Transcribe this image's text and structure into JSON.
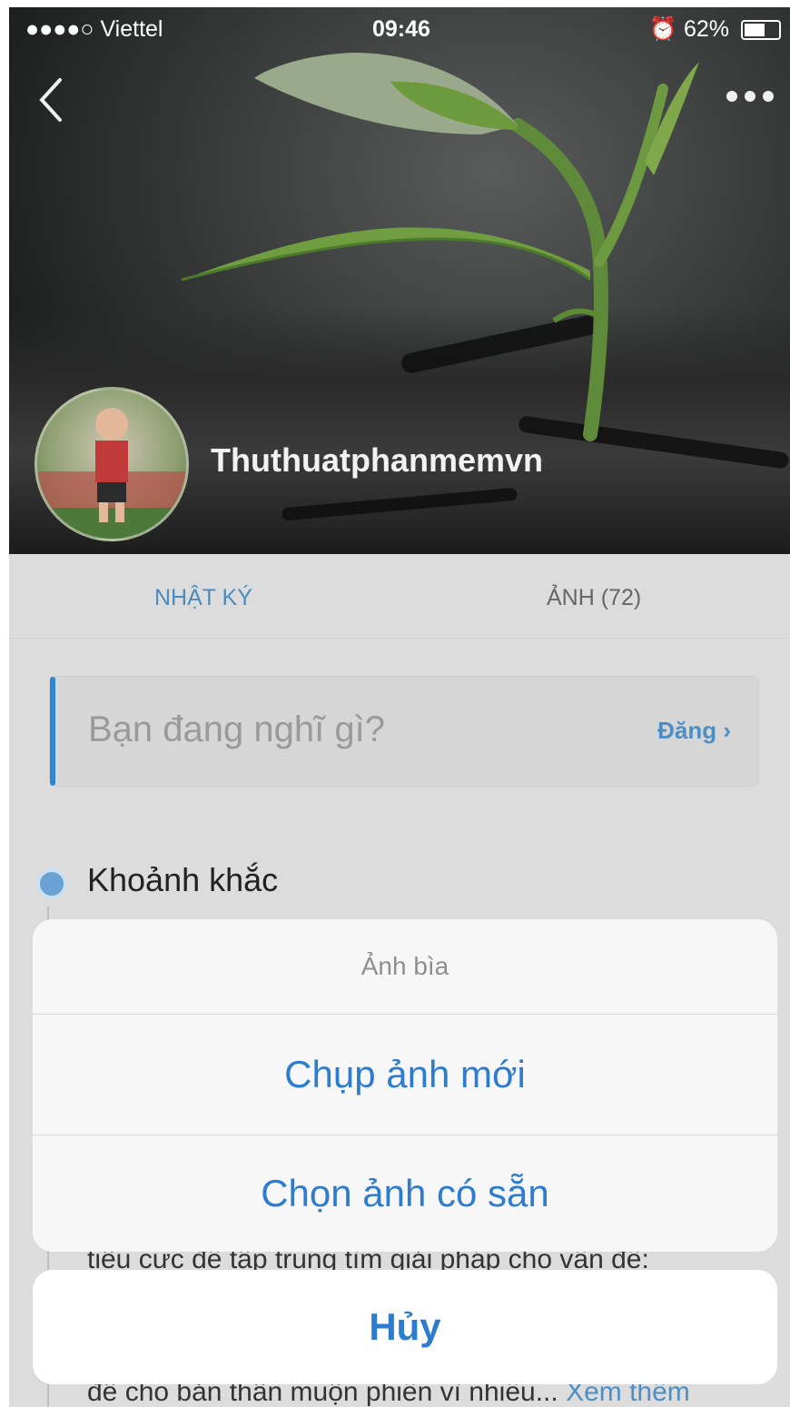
{
  "status_bar": {
    "carrier": "●●●●○ Viettel",
    "time": "09:46",
    "battery": "62%",
    "battery_level": 0.62
  },
  "profile": {
    "name": "Thuthuatphanmemvn"
  },
  "tabs": [
    {
      "label": "NHẬT KÝ"
    },
    {
      "label": "ẢNH (72)"
    }
  ],
  "composer": {
    "placeholder": "Bạn đang nghĩ gì?",
    "post_label": "Đăng"
  },
  "moments": {
    "title": "Khoảnh khắc"
  },
  "background_text": {
    "line1": "tiêu cực để tập trung tìm giải pháp cho vấn đề:",
    "line2": "để cho bản thân muộn phiền vì nhiều...",
    "see_more": "Xem thêm"
  },
  "action_sheet": {
    "title": "Ảnh bìa",
    "options": [
      {
        "label": "Chụp ảnh mới"
      },
      {
        "label": "Chọn ảnh có sẵn"
      }
    ],
    "cancel_label": "Hủy"
  }
}
